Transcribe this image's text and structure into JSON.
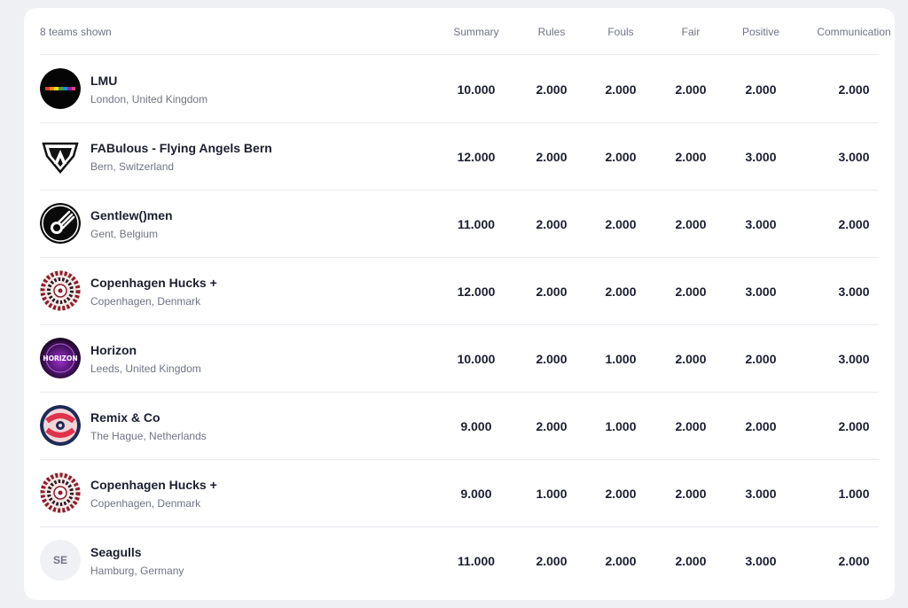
{
  "header": {
    "count_text": "8 teams shown",
    "columns": [
      "Summary",
      "Rules",
      "Fouls",
      "Fair",
      "Positive",
      "Communication"
    ]
  },
  "teams": [
    {
      "name": "LMU",
      "location": "London, United Kingdom",
      "summary": "10.000",
      "rules": "2.000",
      "fouls": "2.000",
      "fair": "2.000",
      "positive": "2.000",
      "communication": "2.000",
      "logo": "lmu-logo-icon"
    },
    {
      "name": "FABulous - Flying Angels Bern",
      "location": "Bern, Switzerland",
      "summary": "12.000",
      "rules": "2.000",
      "fouls": "2.000",
      "fair": "2.000",
      "positive": "3.000",
      "communication": "3.000",
      "logo": "fab-logo-icon"
    },
    {
      "name": "Gentlew()men",
      "location": "Gent, Belgium",
      "summary": "11.000",
      "rules": "2.000",
      "fouls": "2.000",
      "fair": "2.000",
      "positive": "3.000",
      "communication": "2.000",
      "logo": "gentlewomen-logo-icon"
    },
    {
      "name": "Copenhagen Hucks +",
      "location": "Copenhagen, Denmark",
      "summary": "12.000",
      "rules": "2.000",
      "fouls": "2.000",
      "fair": "2.000",
      "positive": "3.000",
      "communication": "3.000",
      "logo": "copenhagen-logo-icon"
    },
    {
      "name": "Horizon",
      "location": "Leeds, United Kingdom",
      "summary": "10.000",
      "rules": "2.000",
      "fouls": "1.000",
      "fair": "2.000",
      "positive": "2.000",
      "communication": "3.000",
      "logo": "horizon-logo-icon",
      "logo_text": "HORIZON"
    },
    {
      "name": "Remix & Co",
      "location": "The Hague, Netherlands",
      "summary": "9.000",
      "rules": "2.000",
      "fouls": "1.000",
      "fair": "2.000",
      "positive": "2.000",
      "communication": "2.000",
      "logo": "remix-logo-icon"
    },
    {
      "name": "Copenhagen Hucks +",
      "location": "Copenhagen, Denmark",
      "summary": "9.000",
      "rules": "1.000",
      "fouls": "2.000",
      "fair": "2.000",
      "positive": "3.000",
      "communication": "1.000",
      "logo": "copenhagen-logo-icon"
    },
    {
      "name": "Seagulls",
      "location": "Hamburg, Germany",
      "summary": "11.000",
      "rules": "2.000",
      "fouls": "2.000",
      "fair": "2.000",
      "positive": "3.000",
      "communication": "2.000",
      "logo": "initials-avatar",
      "initials": "SE"
    }
  ]
}
